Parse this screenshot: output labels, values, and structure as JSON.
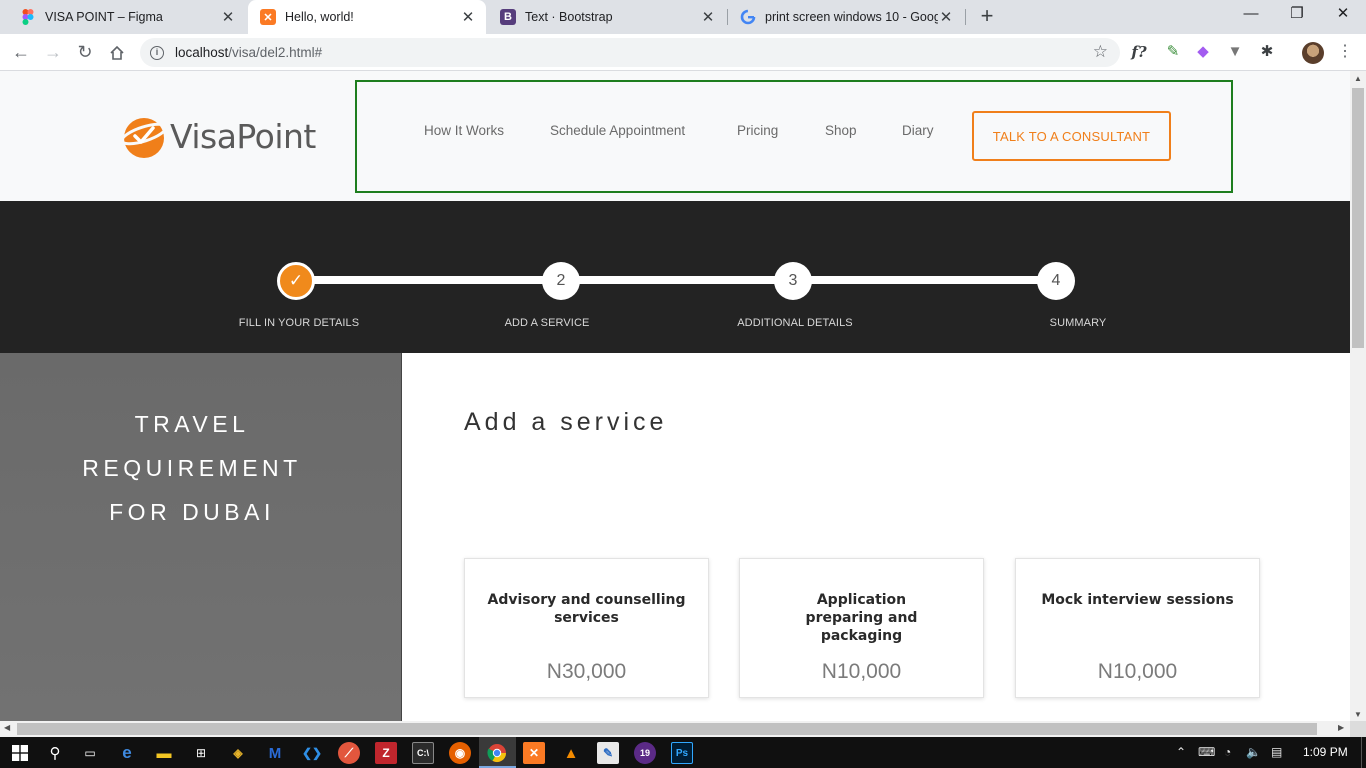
{
  "browser": {
    "tabs": [
      {
        "title": "VISA POINT – Figma",
        "icon": "figma-icon"
      },
      {
        "title": "Hello, world!",
        "icon": "xampp-icon"
      },
      {
        "title": "Text · Bootstrap",
        "icon": "bootstrap-icon"
      },
      {
        "title": "print screen windows 10 - Google",
        "icon": "google-icon"
      }
    ],
    "url_host": "localhost",
    "url_path": "/visa/del2.html#"
  },
  "site": {
    "logo_text": "VisaPoint",
    "nav": [
      "How It Works",
      "Schedule Appointment",
      "Pricing",
      "Shop",
      "Diary"
    ],
    "cta_label": "TALK TO A CONSULTANT",
    "accent_color": "#f07f1a"
  },
  "stepper": {
    "steps": [
      {
        "number": "✓",
        "label": "FILL IN YOUR DETAILS",
        "done": true
      },
      {
        "number": "2",
        "label": "ADD A SERVICE",
        "done": false
      },
      {
        "number": "3",
        "label": "ADDITIONAL DETAILS",
        "done": false
      },
      {
        "number": "4",
        "label": "SUMMARY",
        "done": false
      }
    ]
  },
  "sidebar": {
    "lines": [
      "TRAVEL",
      "REQUIREMENT",
      "FOR DUBAI"
    ]
  },
  "main": {
    "title": "Add a service",
    "services": [
      {
        "name": "Advisory and counselling services",
        "price": "N30,000"
      },
      {
        "name": "Application preparing and packaging",
        "price": "N10,000"
      },
      {
        "name": "Mock interview sessions",
        "price": "N10,000"
      }
    ]
  },
  "taskbar": {
    "time": "1:09 PM"
  }
}
